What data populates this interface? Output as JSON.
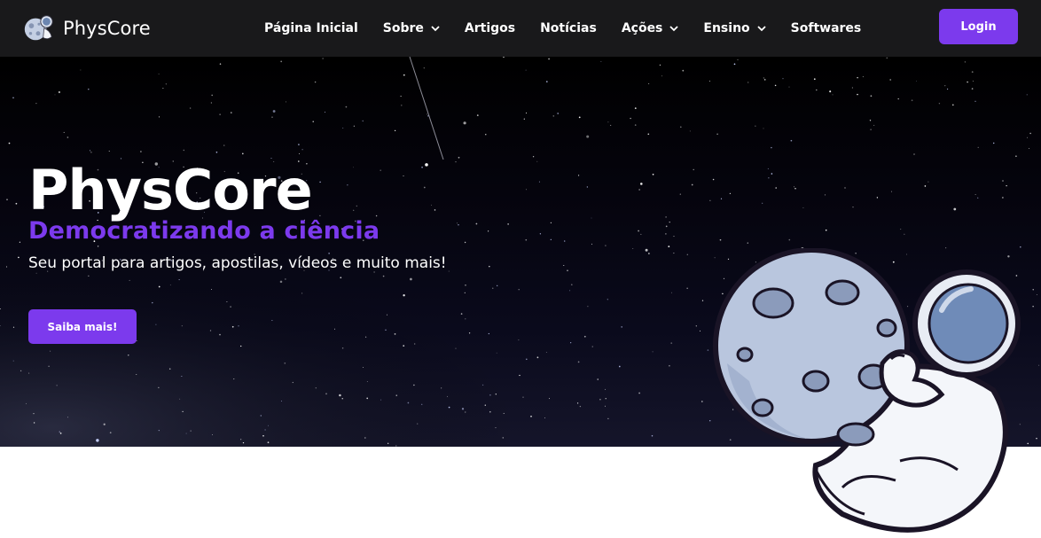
{
  "brand": {
    "name": "PhysCore",
    "logo_icon": "astronaut-moon-logo-icon"
  },
  "nav": {
    "items": [
      {
        "label": "Página Inicial",
        "has_dropdown": false
      },
      {
        "label": "Sobre",
        "has_dropdown": true
      },
      {
        "label": "Artigos",
        "has_dropdown": false
      },
      {
        "label": "Notícias",
        "has_dropdown": false
      },
      {
        "label": "Ações",
        "has_dropdown": true
      },
      {
        "label": "Ensino",
        "has_dropdown": true
      },
      {
        "label": "Softwares",
        "has_dropdown": false
      }
    ],
    "login_label": "Login"
  },
  "hero": {
    "title": "PhysCore",
    "subtitle": "Democratizando a ciência",
    "description": "Seu portal para artigos, apostilas, vídeos e muito mais!",
    "cta_label": "Saiba mais!",
    "background": "starry-night-sky",
    "illustration": "astronaut-holding-moon-illustration"
  },
  "colors": {
    "accent": "#7c3aed",
    "navbar_bg": "#19191b",
    "hero_bg": "#000000",
    "text_light": "#ffffff",
    "page_bg": "#ffffff"
  }
}
